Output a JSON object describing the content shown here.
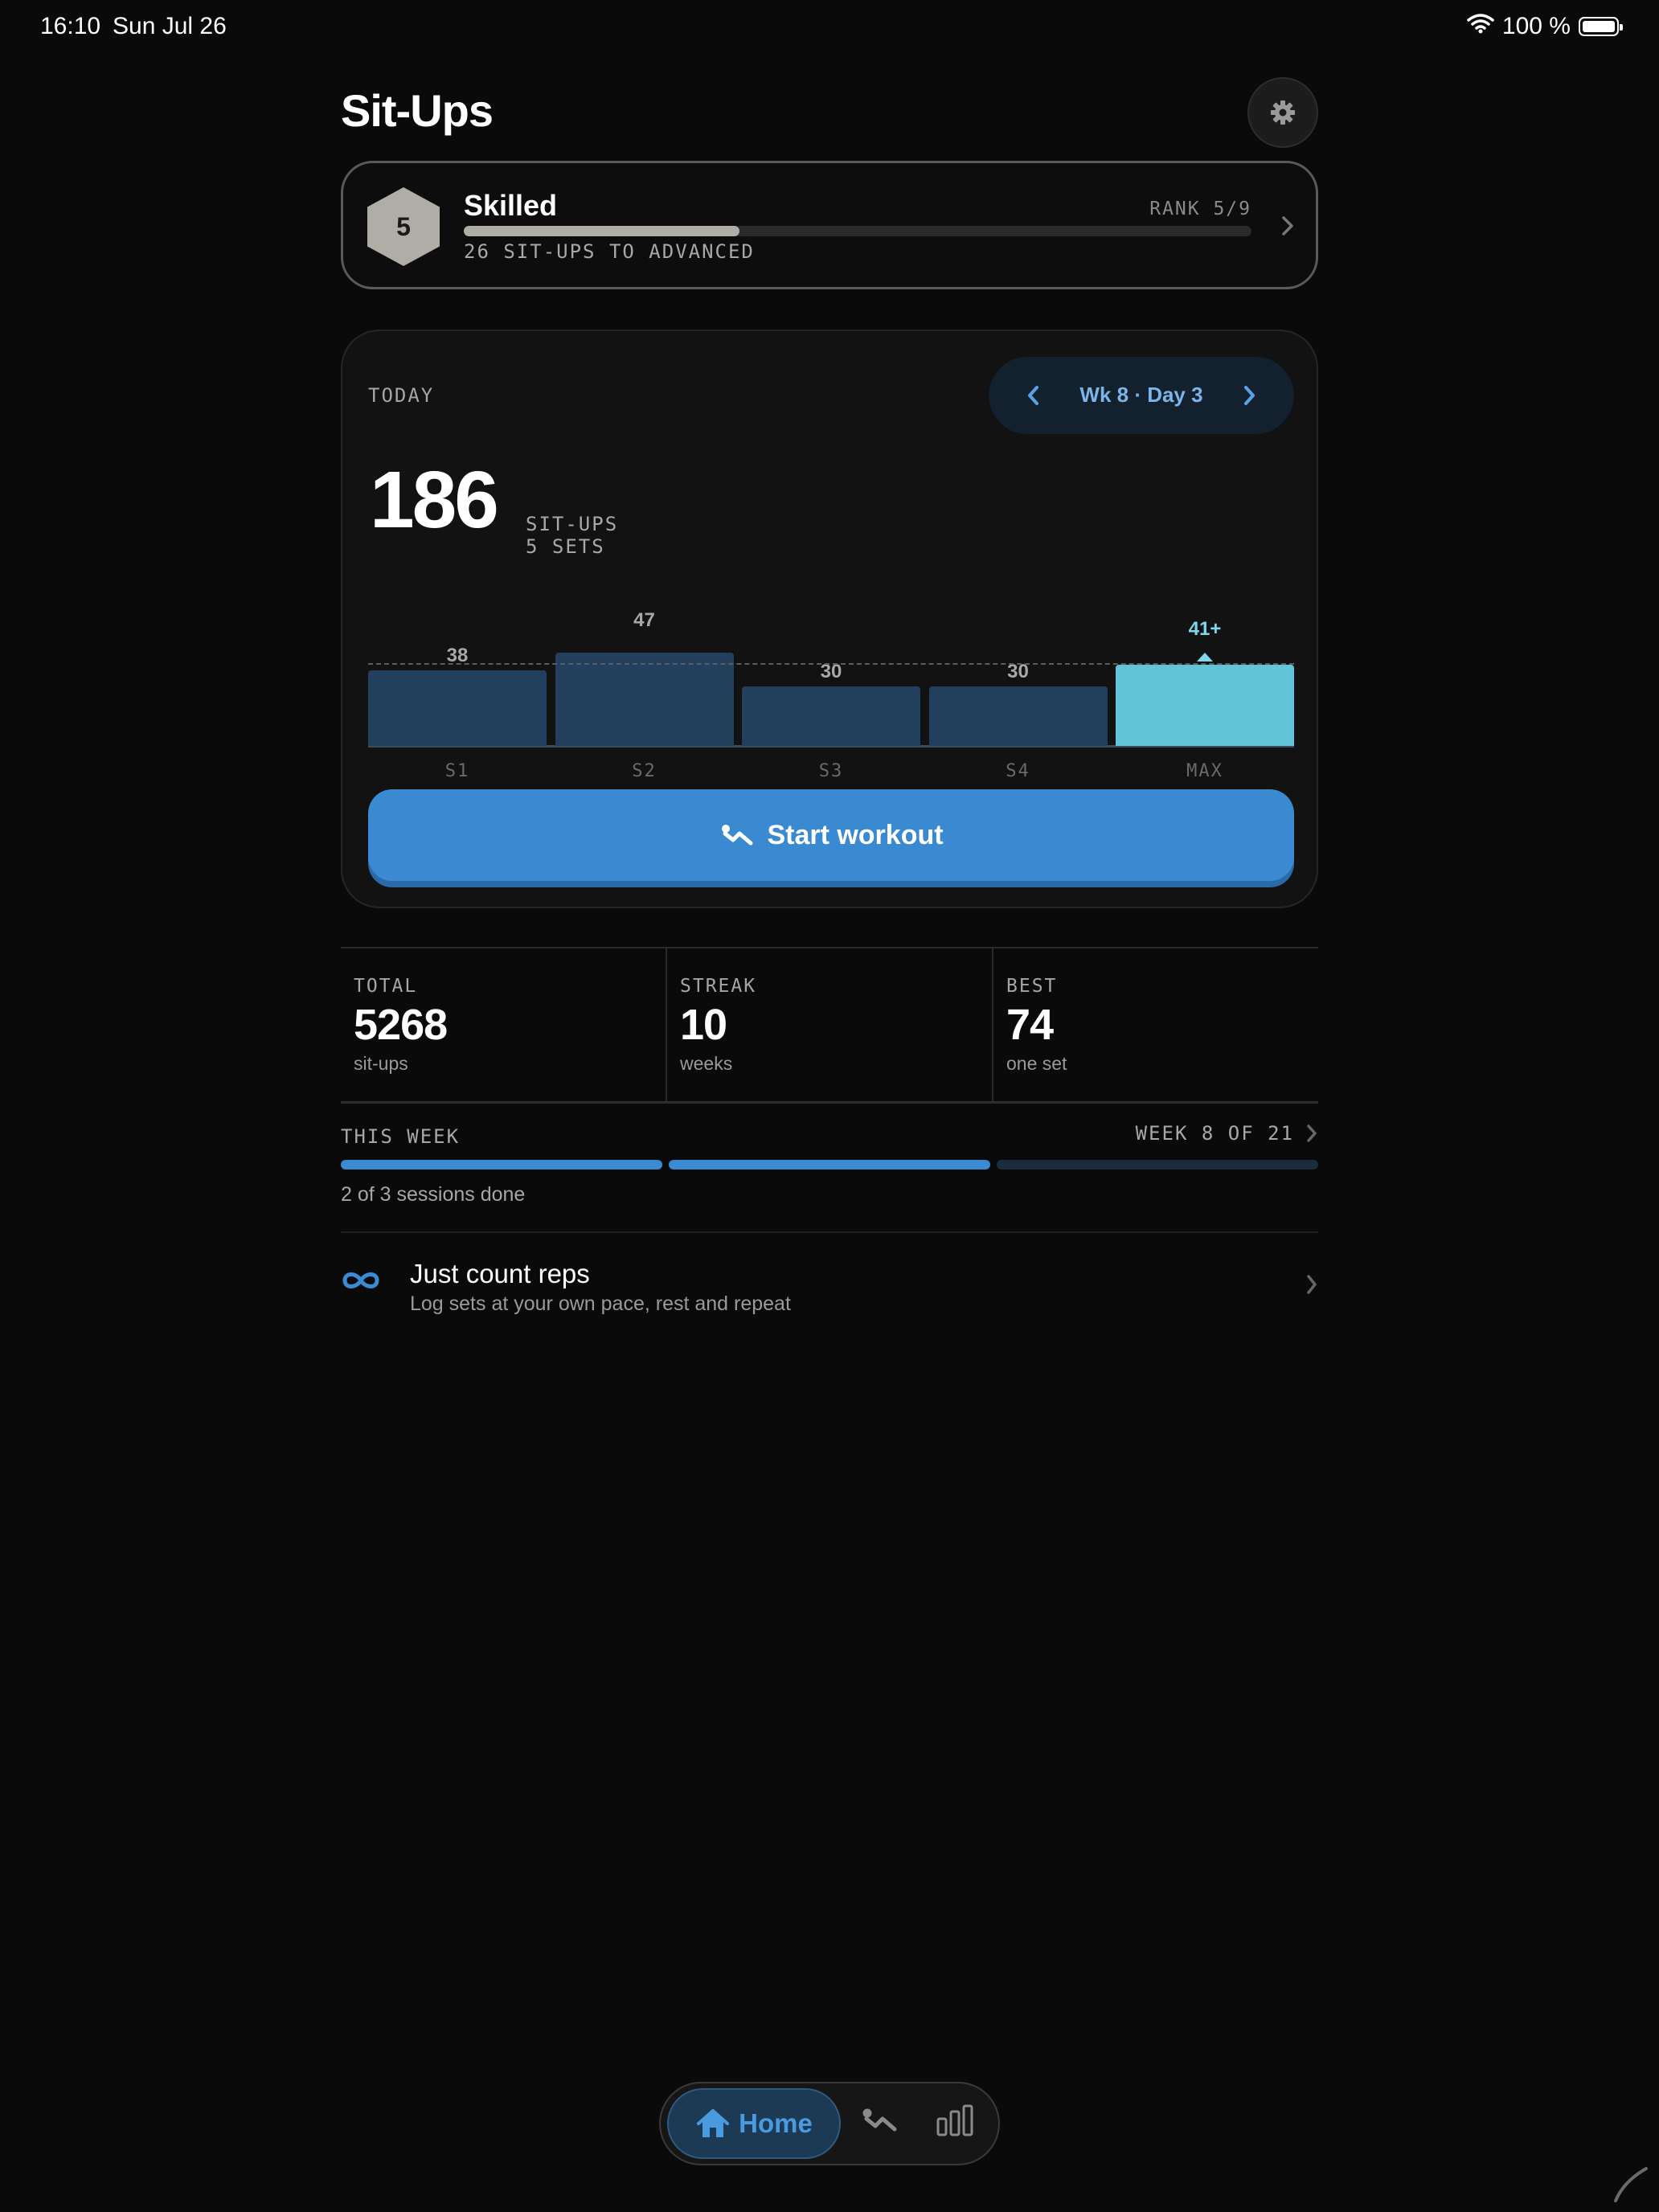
{
  "status": {
    "time": "16:10",
    "date": "Sun Jul 26",
    "battery": "100 %"
  },
  "header": {
    "title": "Sit-Ups"
  },
  "rank": {
    "level": "5",
    "name": "Skilled",
    "label": "RANK 5/9",
    "progress": 0.35,
    "subtitle": "26 SIT-UPS TO ADVANCED",
    "badge_color": "#b0aca6"
  },
  "today": {
    "label": "TODAY",
    "day": "Wk 8 · Day 3",
    "total": "186",
    "unit": "SIT-UPS",
    "sets": "5 SETS",
    "start_label": "Start workout"
  },
  "chart_data": {
    "type": "bar",
    "categories": [
      "S1",
      "S2",
      "S3",
      "S4",
      "MAX"
    ],
    "values": [
      38,
      47,
      30,
      30,
      41
    ],
    "labels": [
      "38",
      "47",
      "30",
      "30",
      "41+"
    ],
    "target_line": 41,
    "ylim": [
      0,
      47
    ],
    "colors": {
      "set": "#22405e",
      "max": "#62c4d8"
    }
  },
  "stats": [
    {
      "label": "TOTAL",
      "value": "5268",
      "sub": "sit-ups"
    },
    {
      "label": "STREAK",
      "value": "10",
      "sub": "weeks"
    },
    {
      "label": "BEST",
      "value": "74",
      "sub": "one set"
    }
  ],
  "week": {
    "label": "THIS WEEK",
    "progress_text": "WEEK 8 OF 21",
    "sessions_done": 2,
    "sessions_total": 3,
    "summary": "2 of 3 sessions done"
  },
  "free_mode": {
    "title": "Just count reps",
    "subtitle": "Log sets at your own pace, rest and repeat"
  },
  "tabbar": {
    "home": "Home"
  },
  "colors": {
    "accent": "#3b8ad4",
    "background": "#0a0a0a"
  }
}
